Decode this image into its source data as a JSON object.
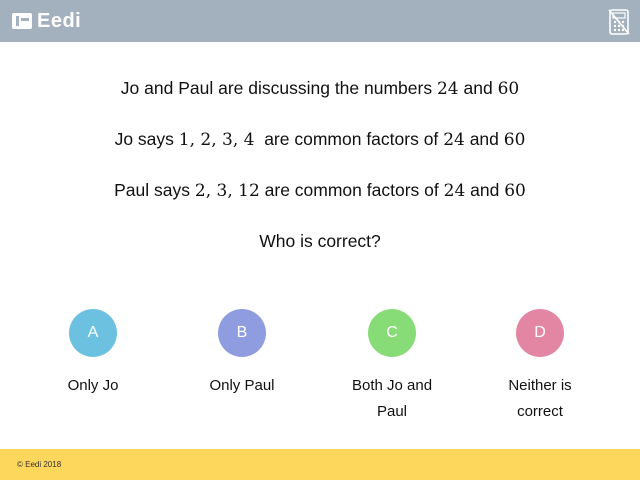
{
  "header": {
    "logo_text": "Eedi",
    "background_color": "#a3b0bd",
    "calculator_icon": "calculator-disabled-icon"
  },
  "question": {
    "line1": {
      "pre": "Jo and Paul are discussing the numbers",
      "n1": "24",
      "mid": "and",
      "n2": "60"
    },
    "line2": {
      "pre": "Jo says",
      "nums": "1, 2, 3, 4",
      "mid": "are common factors of",
      "n1": "24",
      "and": "and",
      "n2": "60"
    },
    "line3": {
      "pre": "Paul says",
      "nums": "2, 3, 12",
      "mid": "are common factors of",
      "n1": "24",
      "and": "and",
      "n2": "60"
    },
    "line4": "Who is correct?"
  },
  "options": [
    {
      "letter": "A",
      "answer": "Only Jo",
      "color": "#6cc0e0"
    },
    {
      "letter": "B",
      "answer": "Only Paul",
      "color": "#8f9ce0"
    },
    {
      "letter": "C",
      "answer": "Both Jo and Paul",
      "color": "#88dc78"
    },
    {
      "letter": "D",
      "answer": "Neither is correct",
      "color": "#e386a4"
    }
  ],
  "footer": {
    "copyright": "© Eedi 2018",
    "background_color": "#fdd65c"
  }
}
